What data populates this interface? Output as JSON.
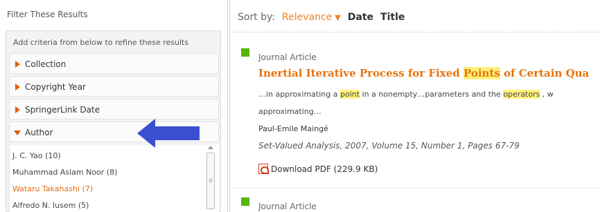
{
  "filter": {
    "title": "Filter These Results",
    "hint": "Add criteria from below to refine these results",
    "facets": [
      {
        "label": "Collection",
        "expanded": false
      },
      {
        "label": "Copyright Year",
        "expanded": false
      },
      {
        "label": "SpringerLink Date",
        "expanded": false
      },
      {
        "label": "Author",
        "expanded": true
      }
    ],
    "authors": [
      {
        "label": "J. C. Yao (10)"
      },
      {
        "label": "Muhammad Aslam Noor (8)"
      },
      {
        "label": "Wataru Takahashi (7)"
      },
      {
        "label": "Alfredo N. Iusem (5)"
      }
    ]
  },
  "sort": {
    "label": "Sort by:",
    "relevance": "Relevance",
    "caret": "▼",
    "date": "Date",
    "title": "Title"
  },
  "results": [
    {
      "type": "Journal Article",
      "title_pre": "Inertial Iterative Process for Fixed ",
      "title_hl": "Points",
      "title_post": " of Certain Qua",
      "snippet_1a": "…in approximating a ",
      "snippet_1b": "point",
      "snippet_1c": " in a nonempty…parameters and the ",
      "snippet_1d": "operators",
      "snippet_1e": " , w",
      "snippet_2": "approximating…",
      "author": "Paul-Emile Maingé",
      "journal": "Set-Valued Analysis, 2007, Volume 15, Number 1, Pages 67-79",
      "pdf_label": "Download PDF (229.9 KB)"
    },
    {
      "type": "Journal Article"
    }
  ],
  "colors": {
    "accent_orange": "#e8720c",
    "highlight": "#fff27a",
    "article_square": "#55b400",
    "arrow_blue": "#3a4fd0"
  },
  "icons": {
    "collapsed": "triangle-right-icon",
    "expanded": "triangle-down-icon",
    "pdf": "pdf-icon",
    "annotation": "left-arrow-icon"
  }
}
